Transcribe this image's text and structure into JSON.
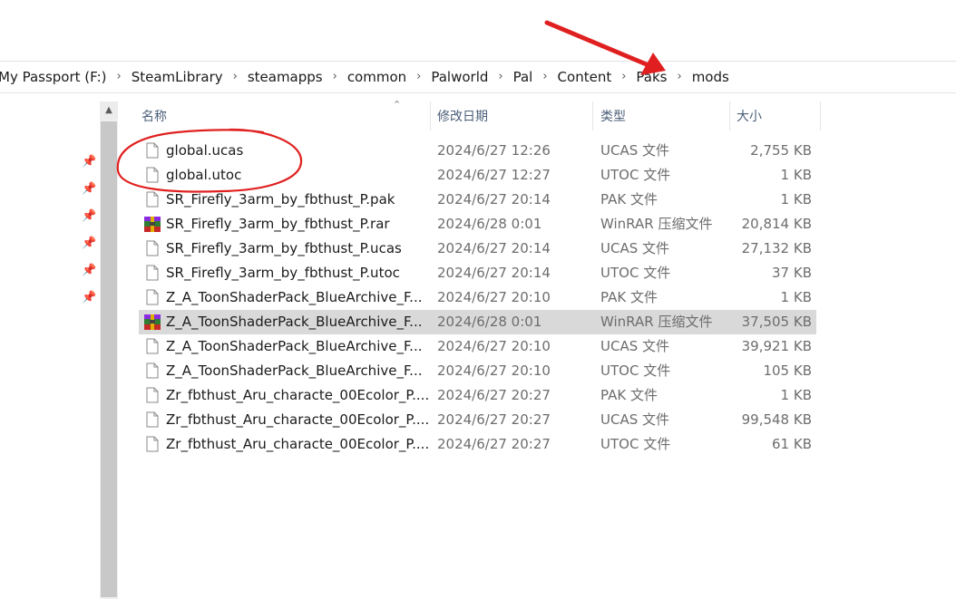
{
  "breadcrumb": [
    "My Passport (F:)",
    "SteamLibrary",
    "steamapps",
    "common",
    "Palworld",
    "Pal",
    "Content",
    "Paks",
    "mods"
  ],
  "columns": {
    "name": "名称",
    "modified": "修改日期",
    "type": "类型",
    "size": "大小"
  },
  "files": [
    {
      "name": "global.ucas",
      "modified": "2024/6/27 12:26",
      "type": "UCAS 文件",
      "size": "2,755 KB",
      "icon": "file"
    },
    {
      "name": "global.utoc",
      "modified": "2024/6/27 12:27",
      "type": "UTOC 文件",
      "size": "1 KB",
      "icon": "file"
    },
    {
      "name": "SR_Firefly_3arm_by_fbthust_P.pak",
      "modified": "2024/6/27 20:14",
      "type": "PAK 文件",
      "size": "1 KB",
      "icon": "file"
    },
    {
      "name": "SR_Firefly_3arm_by_fbthust_P.rar",
      "modified": "2024/6/28 0:01",
      "type": "WinRAR 压缩文件",
      "size": "20,814 KB",
      "icon": "winrar"
    },
    {
      "name": "SR_Firefly_3arm_by_fbthust_P.ucas",
      "modified": "2024/6/27 20:14",
      "type": "UCAS 文件",
      "size": "27,132 KB",
      "icon": "file"
    },
    {
      "name": "SR_Firefly_3arm_by_fbthust_P.utoc",
      "modified": "2024/6/27 20:14",
      "type": "UTOC 文件",
      "size": "37 KB",
      "icon": "file"
    },
    {
      "name": "Z_A_ToonShaderPack_BlueArchive_F...",
      "modified": "2024/6/27 20:10",
      "type": "PAK 文件",
      "size": "1 KB",
      "icon": "file"
    },
    {
      "name": "Z_A_ToonShaderPack_BlueArchive_F...",
      "modified": "2024/6/28 0:01",
      "type": "WinRAR 压缩文件",
      "size": "37,505 KB",
      "icon": "winrar",
      "selected": true
    },
    {
      "name": "Z_A_ToonShaderPack_BlueArchive_F...",
      "modified": "2024/6/27 20:10",
      "type": "UCAS 文件",
      "size": "39,921 KB",
      "icon": "file"
    },
    {
      "name": "Z_A_ToonShaderPack_BlueArchive_F...",
      "modified": "2024/6/27 20:10",
      "type": "UTOC 文件",
      "size": "105 KB",
      "icon": "file"
    },
    {
      "name": "Zr_fbthust_Aru_characte_00Ecolor_P....",
      "modified": "2024/6/27 20:27",
      "type": "PAK 文件",
      "size": "1 KB",
      "icon": "file"
    },
    {
      "name": "Zr_fbthust_Aru_characte_00Ecolor_P....",
      "modified": "2024/6/27 20:27",
      "type": "UCAS 文件",
      "size": "99,548 KB",
      "icon": "file"
    },
    {
      "name": "Zr_fbthust_Aru_characte_00Ecolor_P....",
      "modified": "2024/6/27 20:27",
      "type": "UTOC 文件",
      "size": "61 KB",
      "icon": "file"
    }
  ],
  "colors": {
    "annotation": "#e02020",
    "selected_row": "#d9d9d9",
    "header_text": "#4c607a"
  }
}
